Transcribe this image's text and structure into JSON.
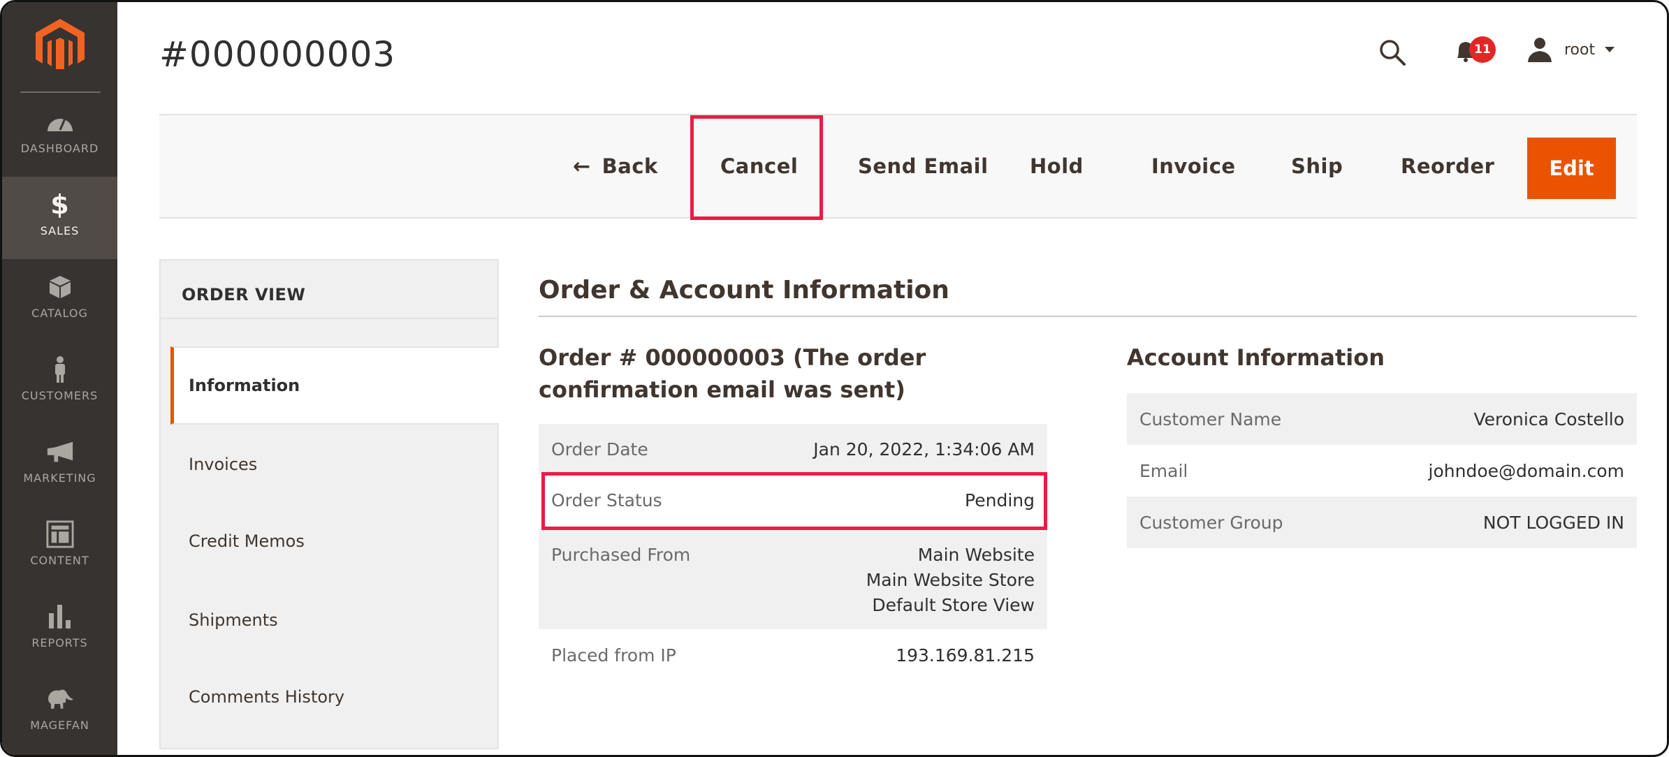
{
  "brand": {
    "accent": "#eb5202",
    "highlight": "#ee1a45",
    "nav_bg": "#373330",
    "link": "#1979c3"
  },
  "nav": {
    "items": [
      {
        "id": "dashboard",
        "label": "DASHBOARD",
        "icon": "dashboard-gauge-icon",
        "active": false
      },
      {
        "id": "sales",
        "label": "SALES",
        "icon": "dollar-icon",
        "active": true
      },
      {
        "id": "catalog",
        "label": "CATALOG",
        "icon": "box-icon",
        "active": false
      },
      {
        "id": "customers",
        "label": "CUSTOMERS",
        "icon": "person-icon",
        "active": false
      },
      {
        "id": "marketing",
        "label": "MARKETING",
        "icon": "megaphone-icon",
        "active": false
      },
      {
        "id": "content",
        "label": "CONTENT",
        "icon": "layout-icon",
        "active": false
      },
      {
        "id": "reports",
        "label": "REPORTS",
        "icon": "bar-chart-icon",
        "active": false
      },
      {
        "id": "magefan",
        "label": "MAGEFAN",
        "icon": "elephant-icon",
        "active": false
      }
    ]
  },
  "header": {
    "title": "#000000003",
    "notifications_count": "11",
    "user": "root"
  },
  "toolbar": {
    "buttons": [
      {
        "id": "back",
        "label": "Back",
        "icon": "arrow-left-icon"
      },
      {
        "id": "cancel",
        "label": "Cancel",
        "highlighted": true
      },
      {
        "id": "send-email",
        "label": "Send Email"
      },
      {
        "id": "hold",
        "label": "Hold"
      },
      {
        "id": "invoice",
        "label": "Invoice"
      },
      {
        "id": "ship",
        "label": "Ship"
      },
      {
        "id": "reorder",
        "label": "Reorder"
      },
      {
        "id": "edit",
        "label": "Edit",
        "primary": true
      }
    ]
  },
  "order_view": {
    "title": "ORDER VIEW",
    "tabs": [
      {
        "label": "Information",
        "active": true
      },
      {
        "label": "Invoices",
        "active": false
      },
      {
        "label": "Credit Memos",
        "active": false
      },
      {
        "label": "Shipments",
        "active": false
      },
      {
        "label": "Comments History",
        "active": false
      }
    ]
  },
  "main": {
    "section_title": "Order & Account Information",
    "order": {
      "title": "Order # 000000003 (The order confirmation email was sent)",
      "rows": [
        {
          "label": "Order Date",
          "value": "Jan 20, 2022, 1:34:06 AM"
        },
        {
          "label": "Order Status",
          "value": "Pending",
          "highlighted": true
        },
        {
          "label": "Purchased From",
          "value_lines": [
            "Main Website",
            "Main Website Store",
            "Default Store View"
          ]
        },
        {
          "label": "Placed from IP",
          "value": "193.169.81.215"
        }
      ]
    },
    "account": {
      "title": "Account Information",
      "rows": [
        {
          "label": "Customer Name",
          "value": "Veronica Costello"
        },
        {
          "label": "Email",
          "value": "johndoe@domain.com",
          "is_link": true
        },
        {
          "label": "Customer Group",
          "value": "NOT LOGGED IN"
        }
      ]
    }
  }
}
